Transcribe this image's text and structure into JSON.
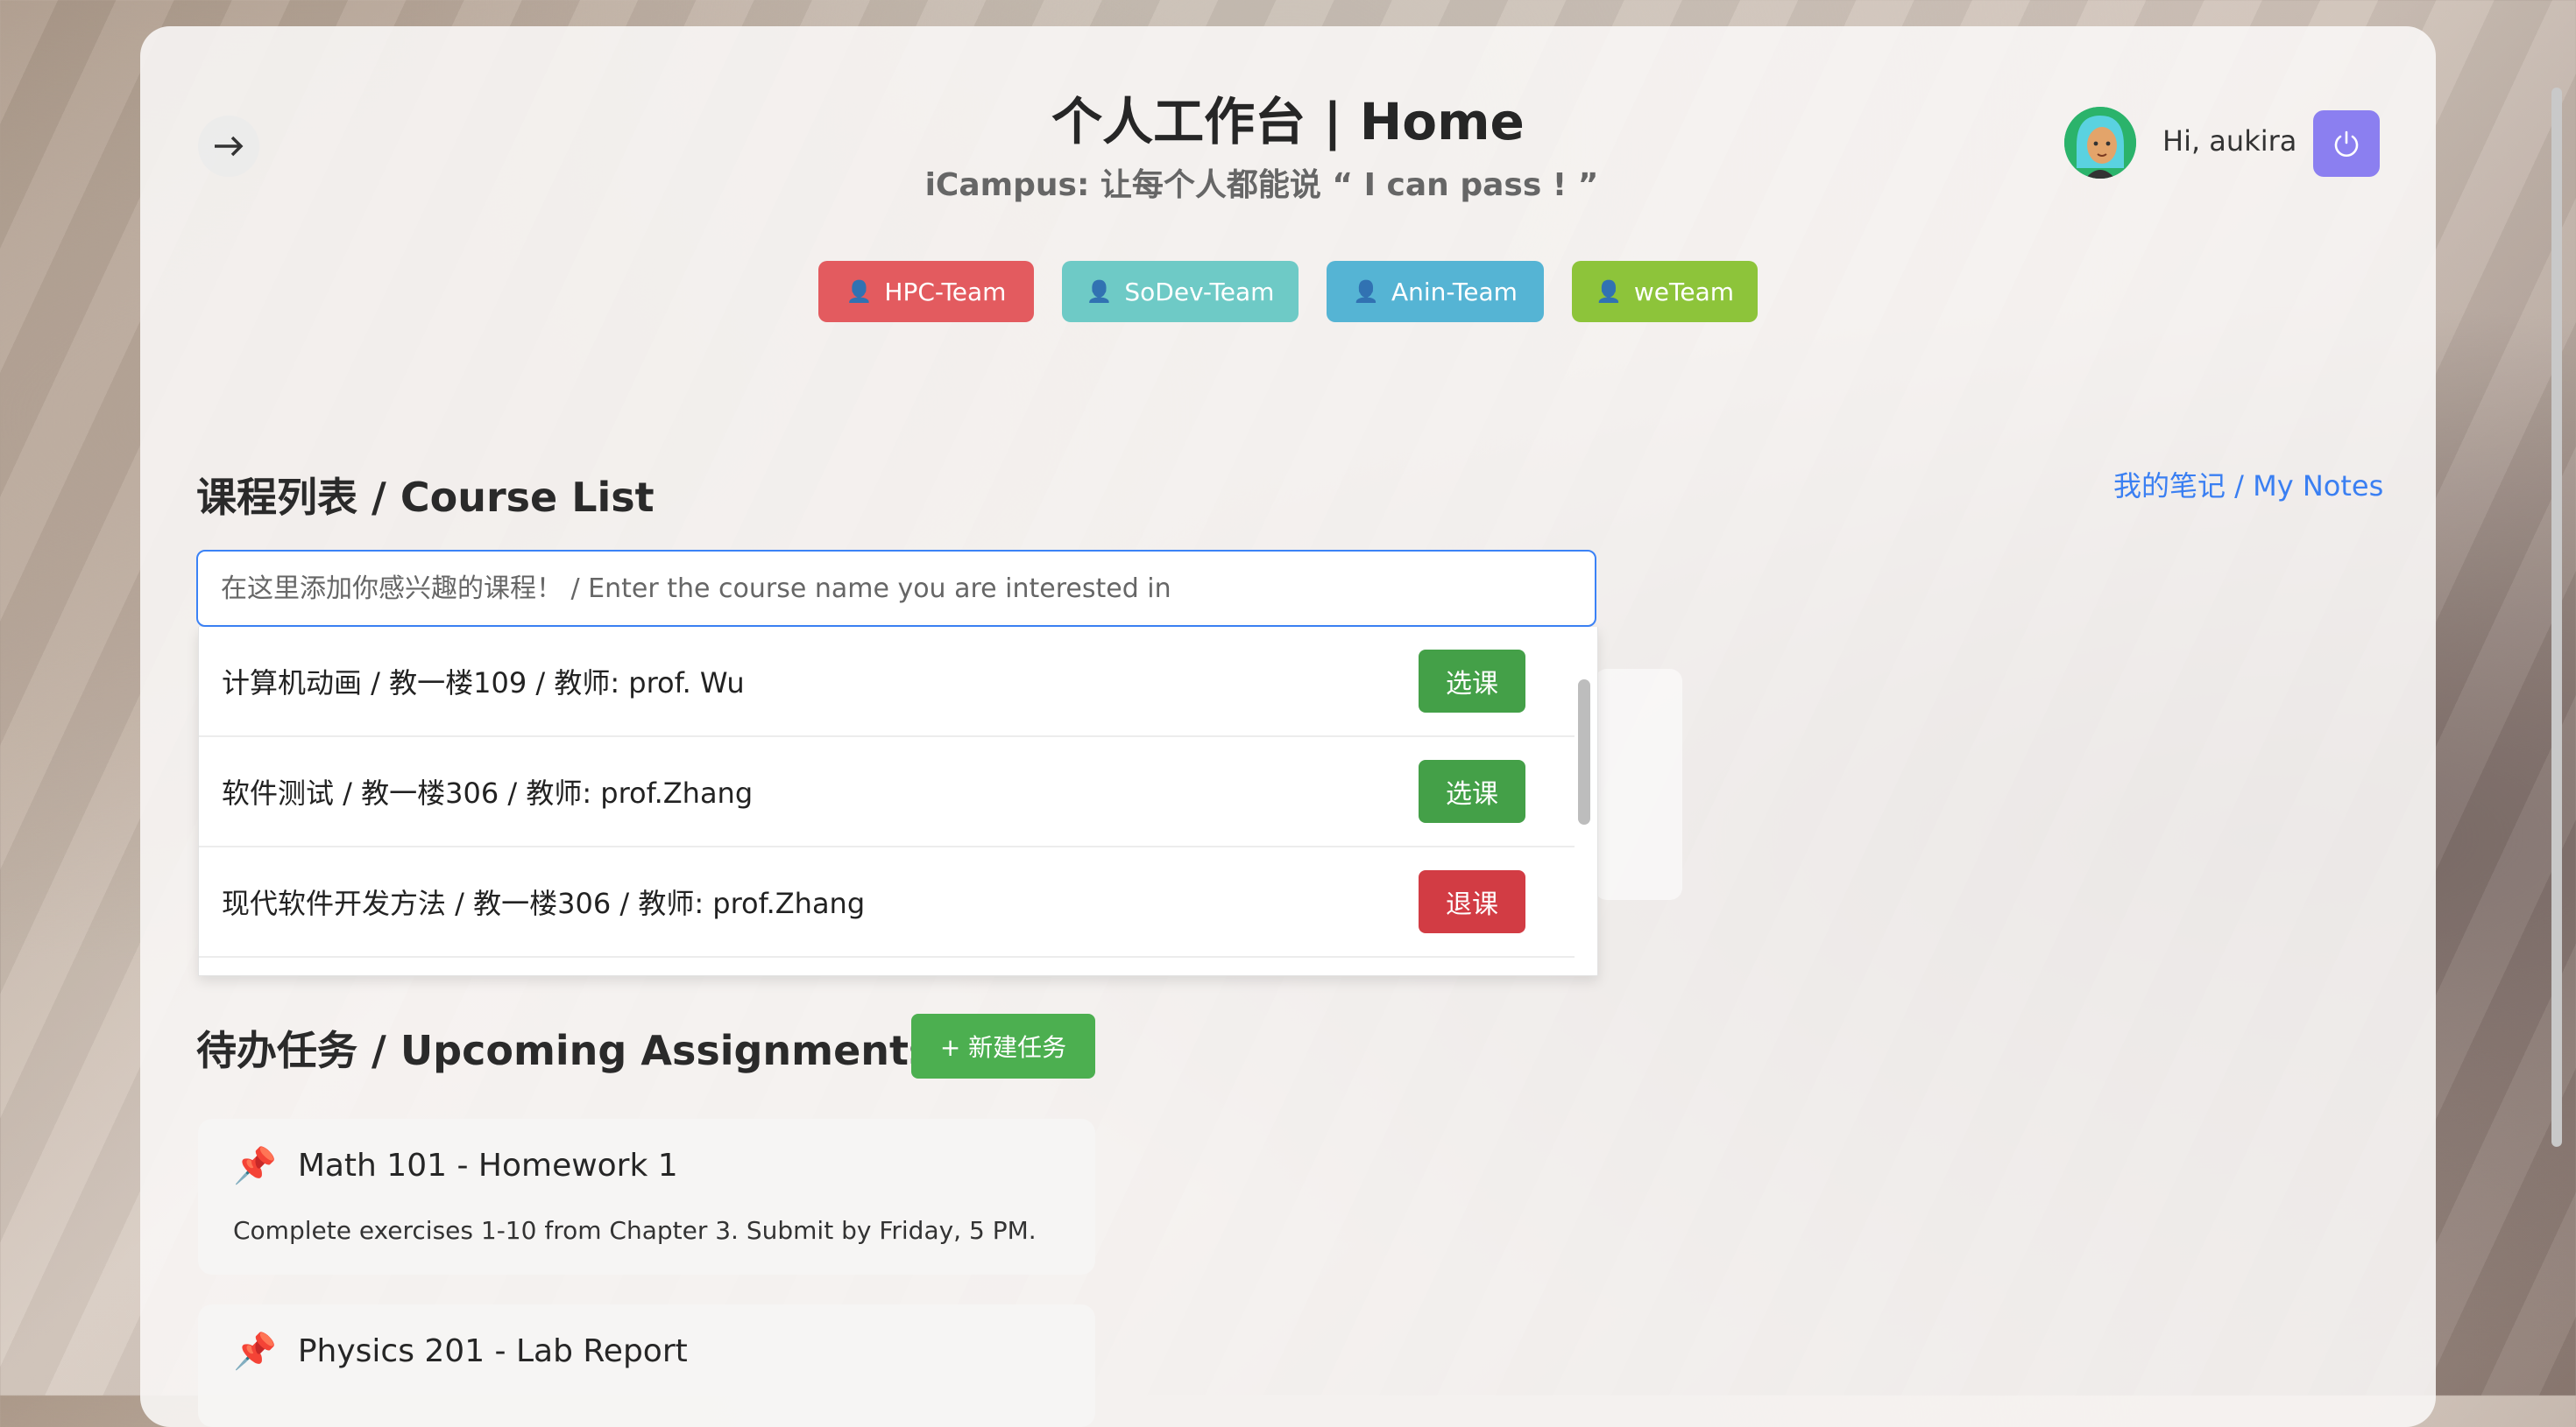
{
  "header": {
    "title": "个人工作台 | Home",
    "subtitle": "iCampus: 让每个人都能说 “ I can pass ! ”",
    "greeting": "Hi, aukira"
  },
  "teams": [
    {
      "label": "HPC-Team",
      "color": "#e35b5f"
    },
    {
      "label": "SoDev-Team",
      "color": "#6ecac6"
    },
    {
      "label": "Anin-Team",
      "color": "#55b4d4"
    },
    {
      "label": "weTeam",
      "color": "#8dc43a"
    }
  ],
  "courses": {
    "section_title": "课程列表 / Course List",
    "notes_link": "我的笔记 / My Notes",
    "search_placeholder": "在这里添加你感兴趣的课程！ / Enter the course name you are interested in",
    "items": [
      {
        "text": "计算机动画 / 教一楼109 / 教师: prof. Wu",
        "action": "选课",
        "state": "enroll"
      },
      {
        "text": "软件测试 / 教一楼306 / 教师: prof.Zhang",
        "action": "选课",
        "state": "enroll"
      },
      {
        "text": "现代软件开发方法 / 教一楼306 / 教师: prof.Zhang",
        "action": "退课",
        "state": "drop"
      }
    ]
  },
  "assignments": {
    "section_title": "待办任务 / Upcoming Assignments",
    "new_task_label": "+ 新建任务",
    "items": [
      {
        "title": "Math 101 - Homework 1",
        "desc": "Complete exercises 1-10 from Chapter 3. Submit by Friday, 5 PM."
      },
      {
        "title": "Physics 201 - Lab Report",
        "desc": ""
      }
    ]
  },
  "icons": {
    "back": "arrow-right-icon",
    "power": "power-icon",
    "pin": "pushpin-icon",
    "team": "user-icon"
  }
}
